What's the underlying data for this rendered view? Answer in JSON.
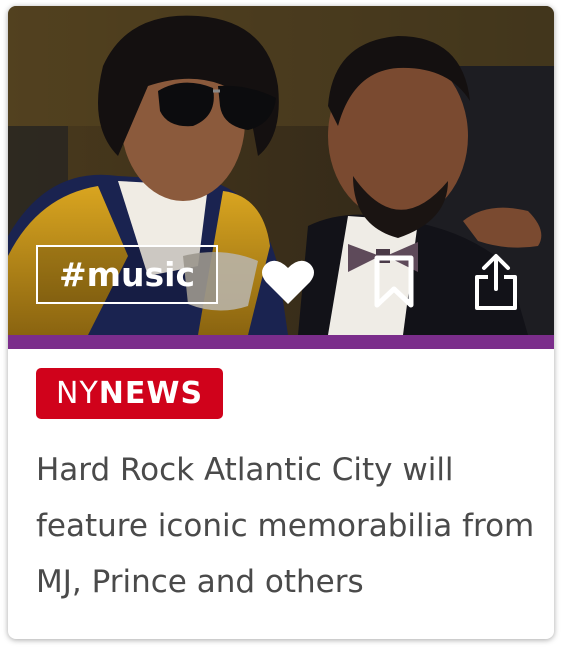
{
  "card": {
    "hashtag": "#music",
    "source": {
      "prefix": "NY",
      "suffix": "NEWS"
    },
    "headline": "Hard Rock Atlantic City will feature iconic memorabilia from MJ, Prince and others",
    "actions": {
      "like_icon": "heart-icon",
      "bookmark_icon": "bookmark-icon",
      "share_icon": "share-icon"
    }
  },
  "colors": {
    "accent_bar": "#7b2d8b",
    "badge": "#d0021b",
    "headline_text": "#4a4a4a"
  }
}
